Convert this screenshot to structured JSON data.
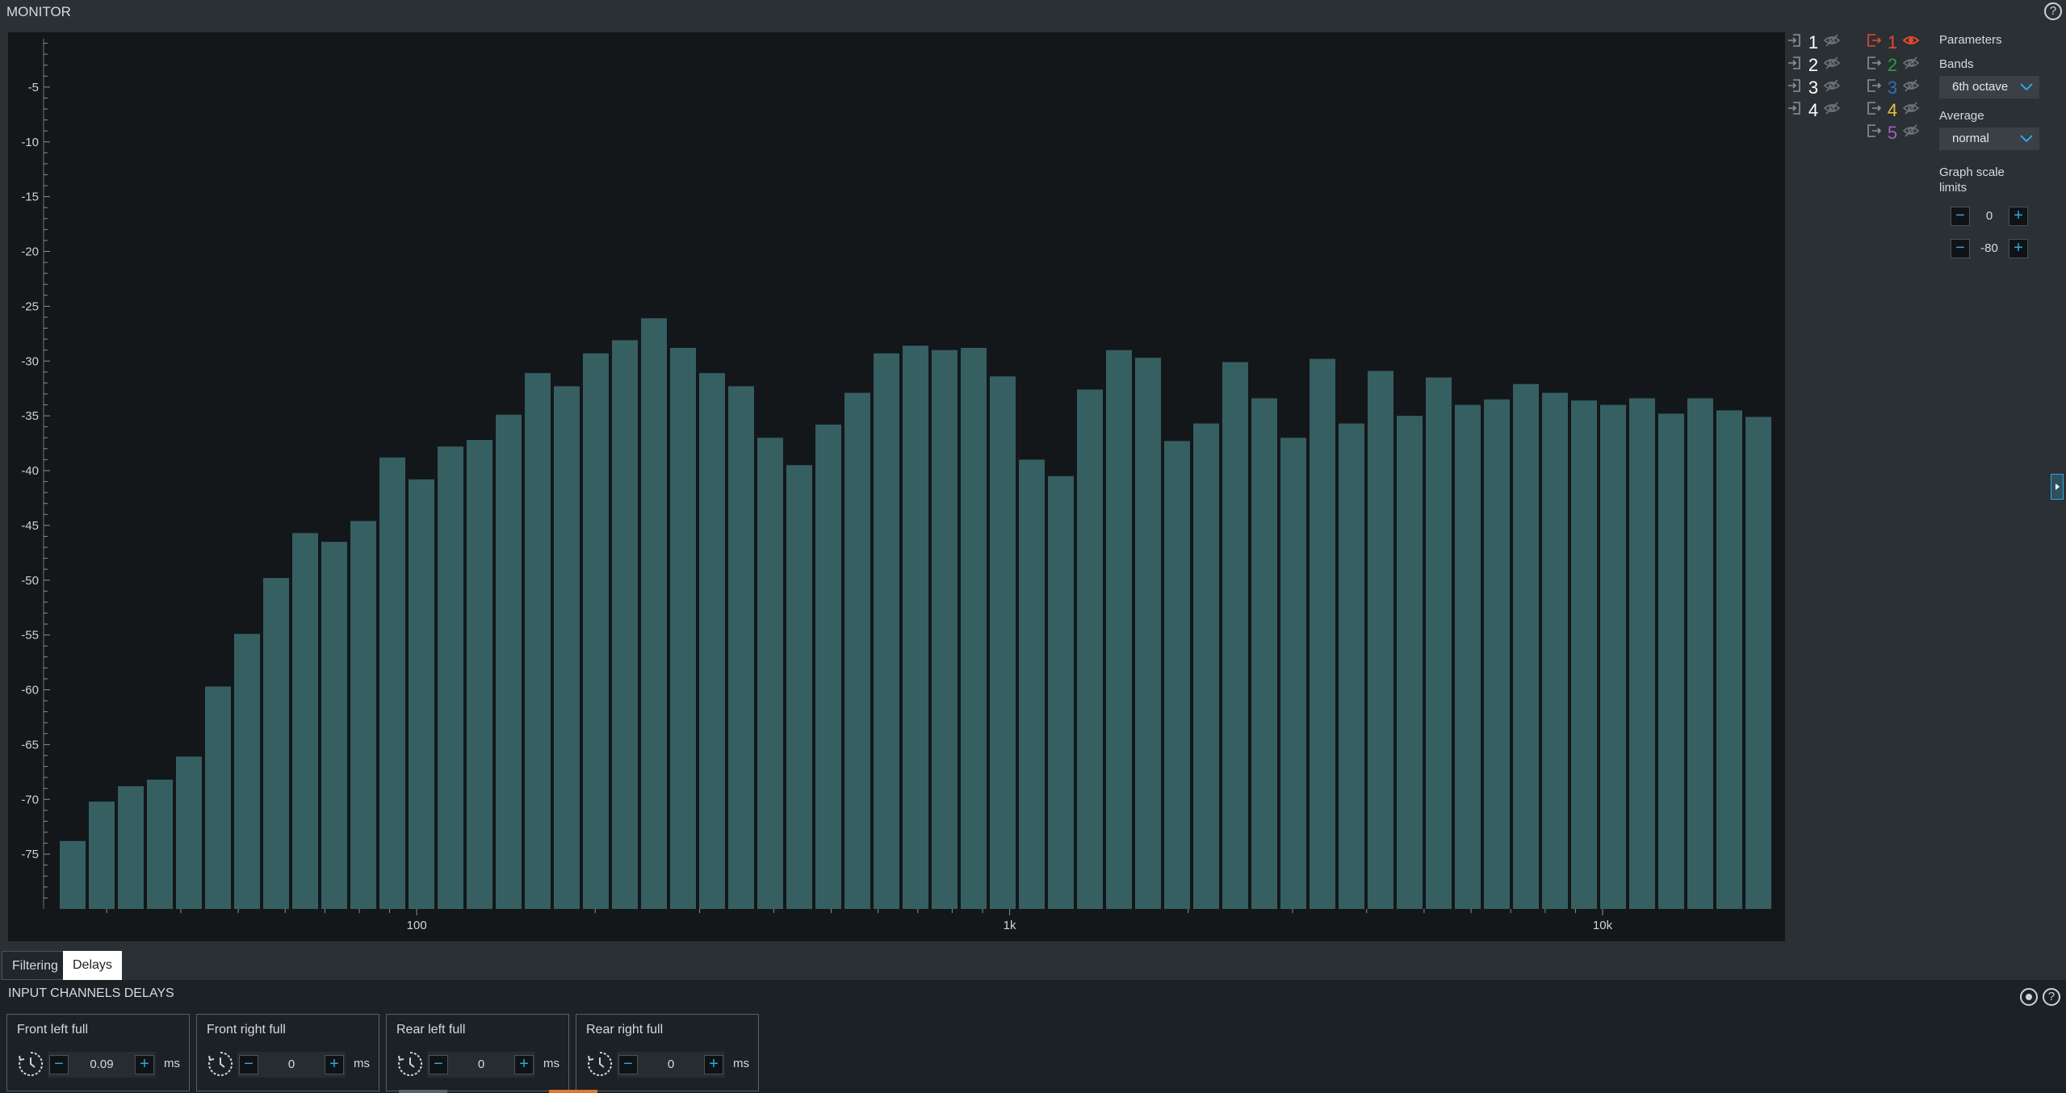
{
  "header": {
    "title": "MONITOR",
    "help": "?"
  },
  "chart_data": {
    "type": "bar",
    "xscale": "log",
    "x_tick_labels": [
      "100",
      "1k",
      "10k"
    ],
    "x": [
      30.9,
      34.7,
      38.9,
      43.7,
      49.0,
      55.0,
      61.7,
      69.3,
      77.8,
      87.3,
      98.0,
      110,
      123,
      139,
      155,
      175,
      196,
      220,
      247,
      277,
      311,
      349,
      392,
      440,
      494,
      554,
      622,
      698,
      784,
      880,
      988,
      1109,
      1245,
      1397,
      1568,
      1760,
      1976,
      2217,
      2489,
      2794,
      3136,
      3520,
      3951,
      4435,
      4978,
      5588,
      6272,
      7040,
      7902,
      8870,
      9956,
      11175,
      12544,
      14080,
      15804
    ],
    "values": [
      -73.8,
      -70.2,
      -68.8,
      -68.2,
      -66.1,
      -59.7,
      -54.9,
      -49.8,
      -45.7,
      -46.5,
      -44.6,
      -38.8,
      -40.8,
      -37.8,
      -37.2,
      -34.9,
      -31.1,
      -32.3,
      -29.3,
      -28.1,
      -26.1,
      -28.8,
      -31.1,
      -32.3,
      -37.0,
      -39.5,
      -35.8,
      -32.9,
      -29.3,
      -28.6,
      -29.0,
      -28.8,
      -31.4,
      -39.0,
      -40.5,
      -32.6,
      -29.0,
      -29.7,
      -37.3,
      -35.7,
      -30.1,
      -33.4,
      -37.0,
      -29.8,
      -35.7,
      -30.9,
      -35.0,
      -31.5,
      -34.0,
      -33.5,
      -32.1,
      -32.9,
      -33.6,
      -34.0,
      -33.4,
      -34.8,
      -33.4,
      -34.5,
      -35.1
    ],
    "bar_color": "#365f62",
    "ylim": [
      -80,
      0
    ],
    "y_tick_labels": [
      "-5",
      "-10",
      "-15",
      "-20",
      "-25",
      "-30",
      "-35",
      "-40",
      "-45",
      "-50",
      "-55",
      "-60",
      "-65",
      "-70",
      "-75"
    ],
    "grid": false
  },
  "channels": {
    "inputs": [
      {
        "num": "1",
        "color": "#ffffff"
      },
      {
        "num": "2",
        "color": "#ffffff"
      },
      {
        "num": "3",
        "color": "#ffffff"
      },
      {
        "num": "4",
        "color": "#ffffff"
      }
    ],
    "outputs": [
      {
        "num": "1",
        "color": "#e84a2f",
        "visible": true
      },
      {
        "num": "2",
        "color": "#2f9a46",
        "visible": false
      },
      {
        "num": "3",
        "color": "#2f6fc4",
        "visible": false
      },
      {
        "num": "4",
        "color": "#e8c23a",
        "visible": false
      },
      {
        "num": "5",
        "color": "#a25fc2",
        "visible": false
      }
    ]
  },
  "parameters": {
    "title": "Parameters",
    "bands_label": "Bands",
    "bands_value": "6th octave",
    "average_label": "Average",
    "average_value": "normal",
    "scale_label_1": "Graph scale",
    "scale_label_2": "limits",
    "scale_max": "0",
    "scale_min": "-80"
  },
  "tabs": [
    {
      "label": "Filtering",
      "active": false
    },
    {
      "label": "Delays",
      "active": true
    }
  ],
  "delays": {
    "title": "INPUT CHANNELS DELAYS",
    "unit": "ms",
    "channels": [
      {
        "label": "Front left full",
        "value": "0.09"
      },
      {
        "label": "Front right full",
        "value": "0"
      },
      {
        "label": "Rear left full",
        "value": "0"
      },
      {
        "label": "Rear right full",
        "value": "0"
      }
    ]
  },
  "colors": {
    "accent": "#2ea7e0",
    "orange_marker": "#e0782e"
  }
}
